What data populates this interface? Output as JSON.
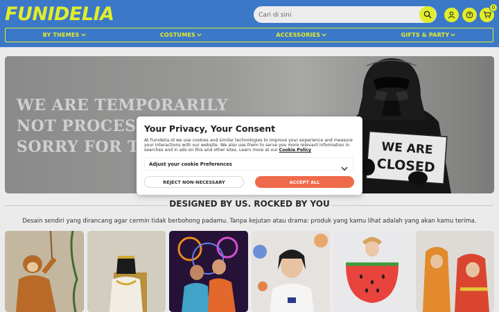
{
  "header": {
    "logo": "FUNIDELIA",
    "search_placeholder": "Cari di sini",
    "cart_count": "0"
  },
  "nav": {
    "items": [
      {
        "label": "BY THEMES"
      },
      {
        "label": "COSTUMES"
      },
      {
        "label": "ACCESSORIES"
      },
      {
        "label": "GIFTS & PARTY"
      }
    ]
  },
  "hero": {
    "lines": [
      "WE ARE TEMPORARILY",
      "NOT PROCESSING",
      "SORRY FOR THE"
    ],
    "sign_text_1": "WE ARE",
    "sign_text_2": "CLOSED"
  },
  "section": {
    "title": "DESIGNED BY US. ROCKED BY YOU",
    "subtitle": "Desain sendiri yang dirancang agar cermin tidak berbohong padamu. Tanpa kejutan atau drama: produk yang kamu lihat adalah yang akan kamu terima."
  },
  "modal": {
    "title": "Your Privacy, Your Consent",
    "body": "At Funidelia.id we use cookies and similar technologies to improve your experience and measure your interactions with our website. We also use them to serve you more relevant information in searches and in ads on this and other sites. Learn more at our",
    "policy_link": "Cookie Policy",
    "prefs_label": "Adjust your cookie Preferences",
    "reject_label": "REJECT NON-NECESSARY",
    "accept_label": "ACCEPT ALL"
  },
  "colors": {
    "brand_blue": "#3c78c8",
    "brand_yellow": "#e1ed2a",
    "accept": "#ee6a4a"
  }
}
